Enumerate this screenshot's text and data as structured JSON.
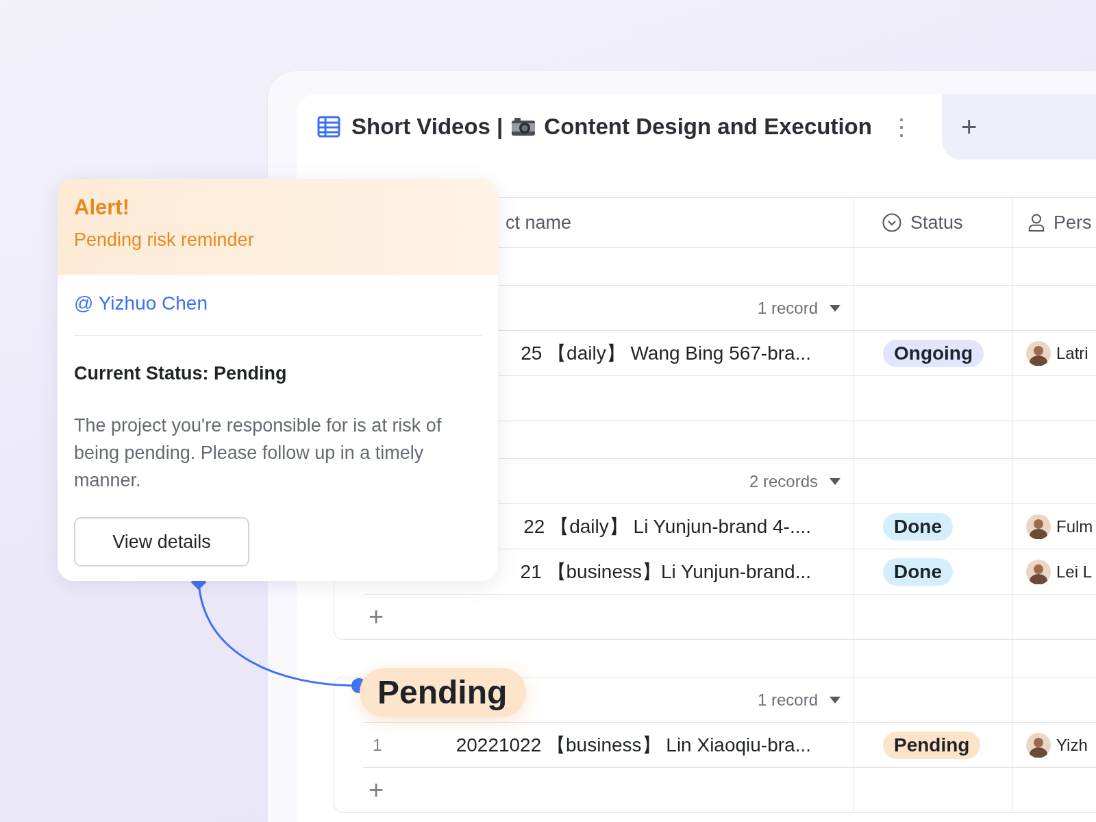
{
  "tab": {
    "title_start": "Short Videos |",
    "title_end": "Content Design and Execution",
    "more": "⋮",
    "add": "+"
  },
  "columns": [
    {
      "kind": "name",
      "label": "ct name"
    },
    {
      "kind": "status",
      "label": "Status"
    },
    {
      "kind": "person",
      "label": "Pers"
    }
  ],
  "groups": [
    {
      "count": "1 record",
      "rows": [
        {
          "name": "25 【daily】 Wang Bing 567-bra...",
          "status": "Ongoing",
          "color": "#e2e5fb",
          "person": "Latri"
        }
      ]
    },
    {
      "count": "2 records",
      "add": "+",
      "rows": [
        {
          "name": "22 【daily】 Li Yunjun-brand 4-....",
          "status": "Done",
          "color": "#d4eefb",
          "person": "Fulm"
        },
        {
          "name": "21 【business】Li Yunjun-brand...",
          "status": "Done",
          "color": "#d4eefb",
          "person": "Lei L"
        }
      ]
    },
    {
      "count": "1 record",
      "add": "+",
      "rows": [
        {
          "number": "1",
          "name": "20221022 【business】 Lin Xiaoqiu-bra...",
          "status": "Pending",
          "color": "#fde4c8",
          "person": "Yizh"
        }
      ]
    }
  ],
  "alert": {
    "title": "Alert!",
    "subtitle": "Pending risk reminder",
    "mention": "@ Yizhuo Chen",
    "status_line": "Current Status: Pending",
    "message": "The project you're responsible for is at risk of being pending. Please follow up in a timely manner.",
    "button": "View details"
  },
  "callout": {
    "label": "Pending"
  }
}
